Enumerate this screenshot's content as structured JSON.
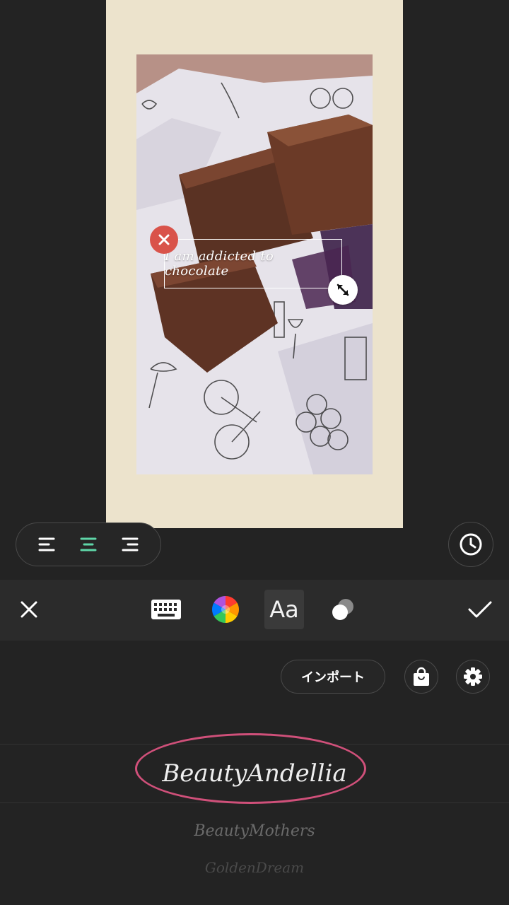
{
  "canvas": {
    "overlay_text": "I am addicted to chocolate"
  },
  "align": {
    "options": [
      "align-left",
      "align-center",
      "align-right"
    ],
    "active": "align-center",
    "active_color": "#5fd6a8"
  },
  "toolbar": {
    "font_label": "Aa",
    "icons": [
      "close-icon",
      "keyboard-icon",
      "color-wheel-icon",
      "font-icon",
      "blend-icon",
      "checkmark-icon"
    ]
  },
  "options": {
    "import_label": "インポート"
  },
  "fonts": {
    "items": [
      "BeautyAndellia",
      "BeautyMothers",
      "GoldenDream"
    ],
    "selected": "BeautyAndellia",
    "highlight_color": "#d0507a"
  }
}
